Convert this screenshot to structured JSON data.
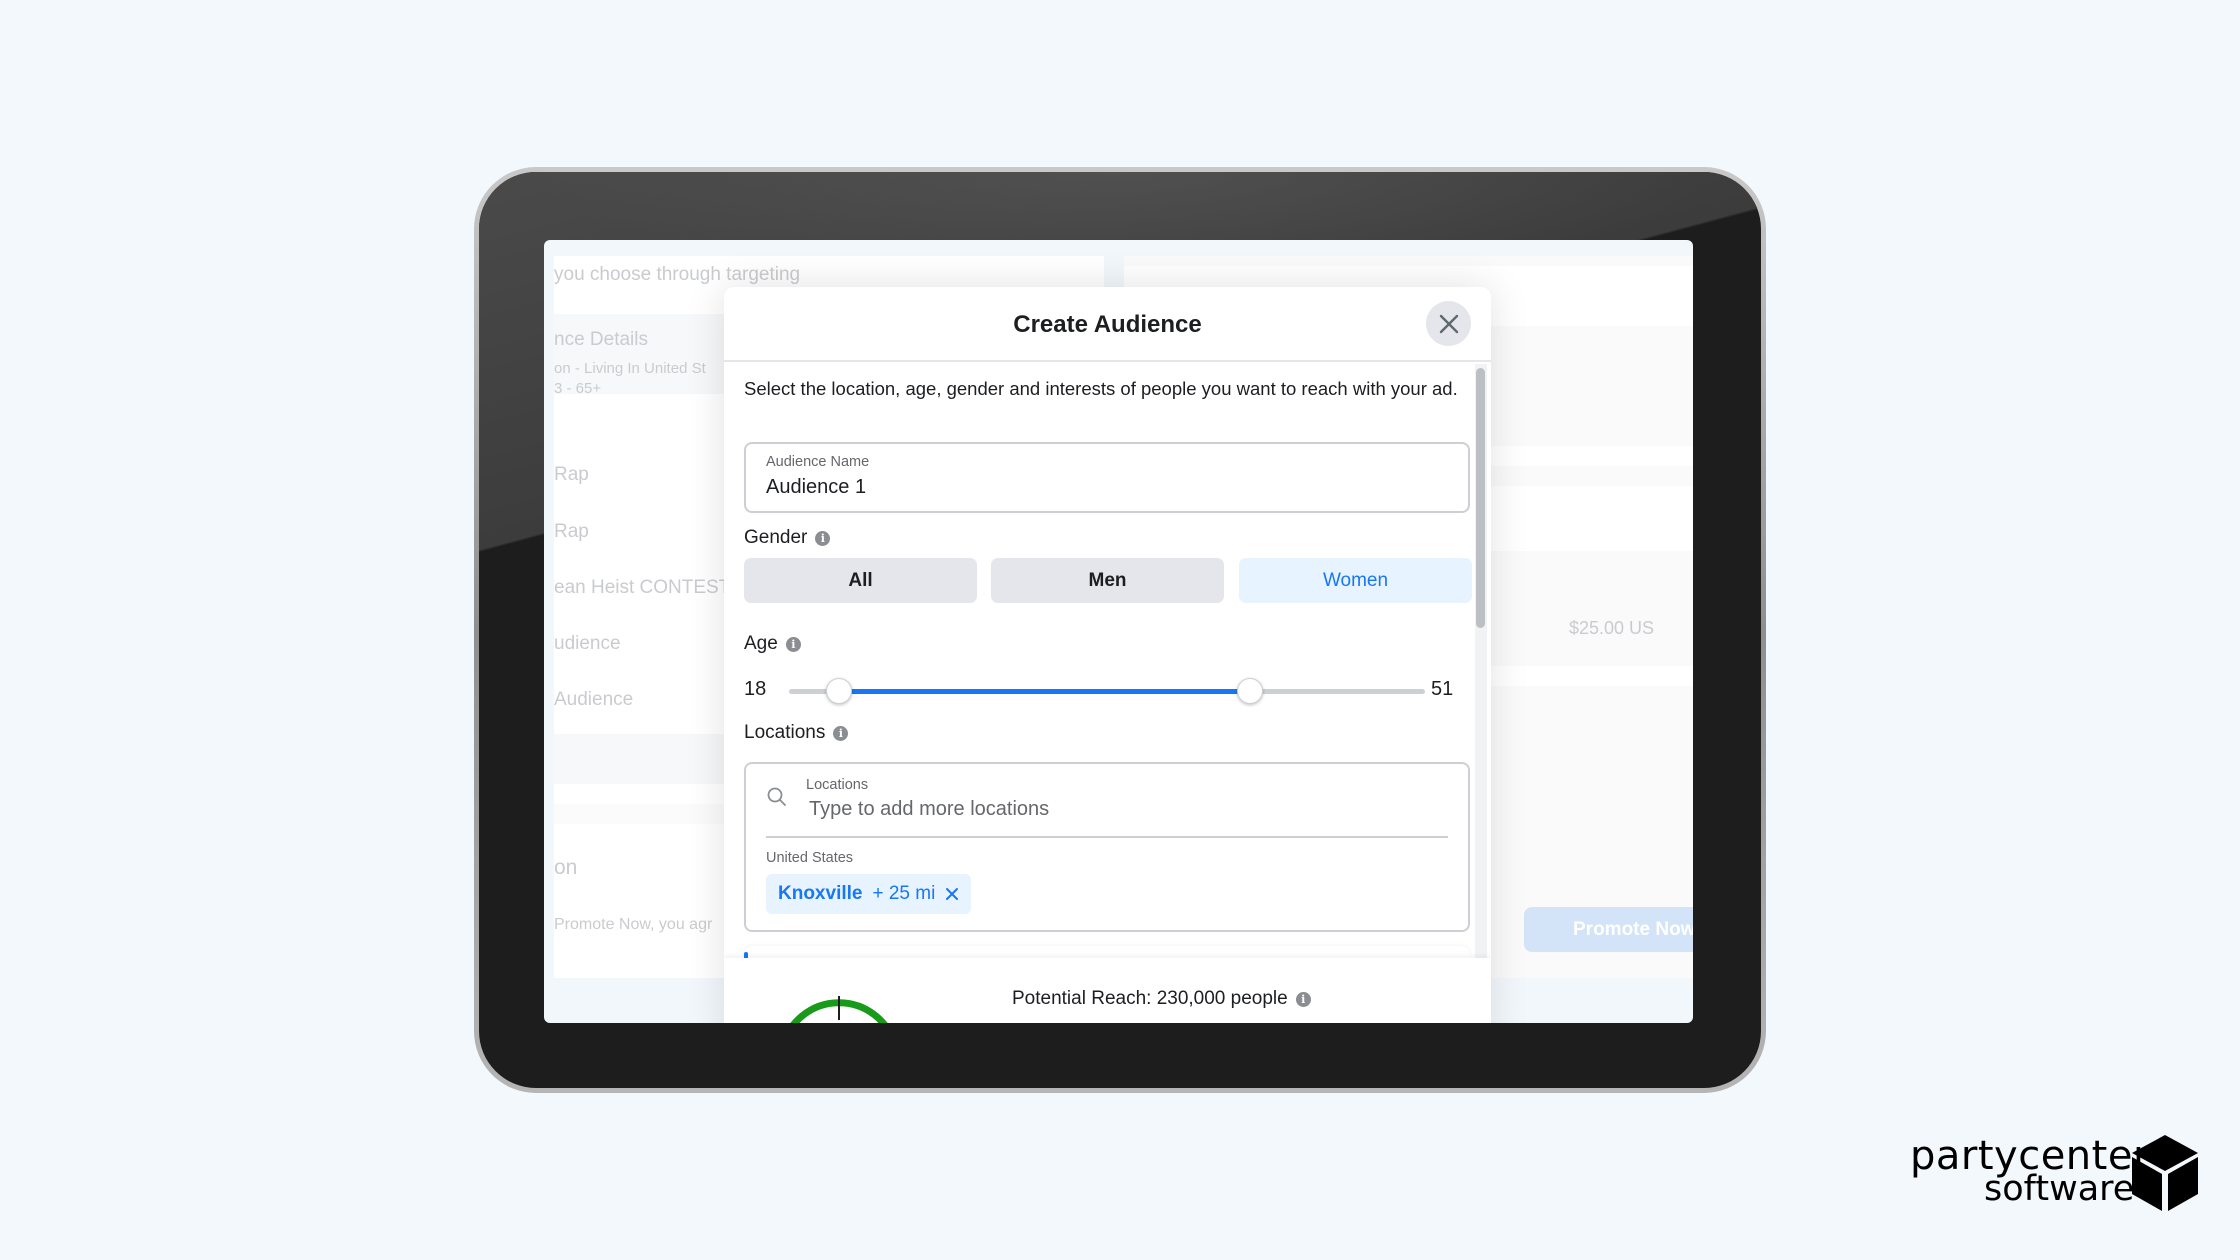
{
  "background_app": {
    "left_panel": {
      "targeting_hint": "you choose through targeting",
      "audience_details_title": "nce Details",
      "audience_details_line1": "on - Living In United St",
      "audience_details_line2": "3 - 65+",
      "list_items": [
        "Rap",
        "Rap",
        "ean Heist CONTEST",
        "udience",
        "Audience"
      ],
      "section_heading": "on",
      "terms_text": "Promote Now, you agr"
    },
    "right_panel": {
      "budget_value": "$25.00 US",
      "promote_button_label": "Promote Now"
    }
  },
  "modal": {
    "title": "Create Audience",
    "close_icon": "close-icon",
    "description": "Select the location, age, gender and interests of people you want to reach with your ad.",
    "audience_name": {
      "label": "Audience Name",
      "value": "Audience 1"
    },
    "gender": {
      "label": "Gender",
      "options": [
        "All",
        "Men",
        "Women"
      ],
      "selected": "Women"
    },
    "age": {
      "label": "Age",
      "min": 18,
      "max": 65,
      "selected_min": 18,
      "selected_max": 51,
      "min_label": "18",
      "max_label": "51"
    },
    "locations": {
      "label": "Locations",
      "search_label": "Locations",
      "search_placeholder": "Type to add more locations",
      "country": "United States",
      "chips": [
        {
          "name": "Knoxville",
          "radius": "+ 25 mi"
        }
      ]
    },
    "footer": {
      "reach_text": "Potential Reach: 230,000 people",
      "gauge_color": "#1a9a1a"
    }
  },
  "colors": {
    "accent": "#1877f2",
    "accent_light": "#e7f3ff",
    "page_bg": "#f3f8fd"
  },
  "brand": {
    "line1": "partycenter",
    "line2": "software"
  }
}
